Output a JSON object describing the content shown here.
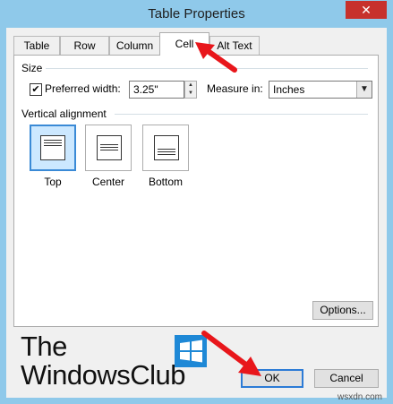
{
  "window": {
    "title": "Table Properties",
    "close_label": "✕"
  },
  "tabs": [
    {
      "label": "Table"
    },
    {
      "label": "Row"
    },
    {
      "label": "Column"
    },
    {
      "label": "Cell",
      "active": true
    },
    {
      "label": "Alt Text"
    }
  ],
  "size_section": {
    "label": "Size",
    "preferred_width_checked": true,
    "preferred_width_label": "Preferred width:",
    "preferred_width_value": "3.25\"",
    "measure_in_label": "Measure in:",
    "measure_in_value": "Inches"
  },
  "vertical_alignment": {
    "label": "Vertical alignment",
    "options": [
      {
        "label": "Top",
        "selected": true
      },
      {
        "label": "Center",
        "selected": false
      },
      {
        "label": "Bottom",
        "selected": false
      }
    ]
  },
  "buttons": {
    "options": "Options...",
    "ok": "OK",
    "cancel": "Cancel"
  },
  "overlay": {
    "logo_line1": "The",
    "logo_line2": "WindowsClub",
    "watermark": "wsxdn.com",
    "arrow_color": "#e8161b"
  },
  "colors": {
    "window_frame": "#8fc9ea",
    "close_button": "#c7312c",
    "selected_accent": "#3a8ad6"
  }
}
